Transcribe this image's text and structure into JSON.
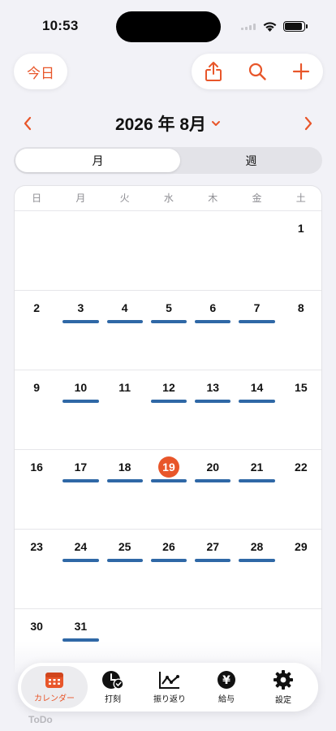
{
  "status_bar": {
    "time": "10:53"
  },
  "header": {
    "today_label": "今日",
    "share_icon": "share-icon",
    "search_icon": "search-icon",
    "add_icon": "plus-icon"
  },
  "month_nav": {
    "title": "2026 年 8月"
  },
  "view_toggle": {
    "month_label": "月",
    "week_label": "週",
    "selected": "月"
  },
  "calendar": {
    "weekdays": [
      "日",
      "月",
      "火",
      "水",
      "木",
      "金",
      "土"
    ],
    "today": 19,
    "weeks": [
      [
        null,
        null,
        null,
        null,
        null,
        null,
        1
      ],
      [
        2,
        3,
        4,
        5,
        6,
        7,
        8
      ],
      [
        9,
        10,
        11,
        12,
        13,
        14,
        15
      ],
      [
        16,
        17,
        18,
        19,
        20,
        21,
        22
      ],
      [
        23,
        24,
        25,
        26,
        27,
        28,
        29
      ],
      [
        30,
        31,
        null,
        null,
        null,
        null,
        null
      ]
    ],
    "event_days": [
      3,
      4,
      5,
      6,
      7,
      10,
      12,
      13,
      14,
      17,
      18,
      19,
      20,
      21,
      24,
      25,
      26,
      27,
      28,
      31
    ],
    "event_color": "#2f68a6"
  },
  "tab_bar": {
    "items": [
      {
        "label": "カレンダー",
        "icon": "calendar-icon",
        "active": true
      },
      {
        "label": "打刻",
        "icon": "clock-check-icon",
        "active": false
      },
      {
        "label": "振り返り",
        "icon": "line-chart-icon",
        "active": false
      },
      {
        "label": "給与",
        "icon": "yen-coin-icon",
        "active": false
      },
      {
        "label": "設定",
        "icon": "gear-icon",
        "active": false
      }
    ]
  },
  "footer_hint": "ToDo",
  "colors": {
    "accent": "#e8562a",
    "background": "#f2f2f7"
  }
}
